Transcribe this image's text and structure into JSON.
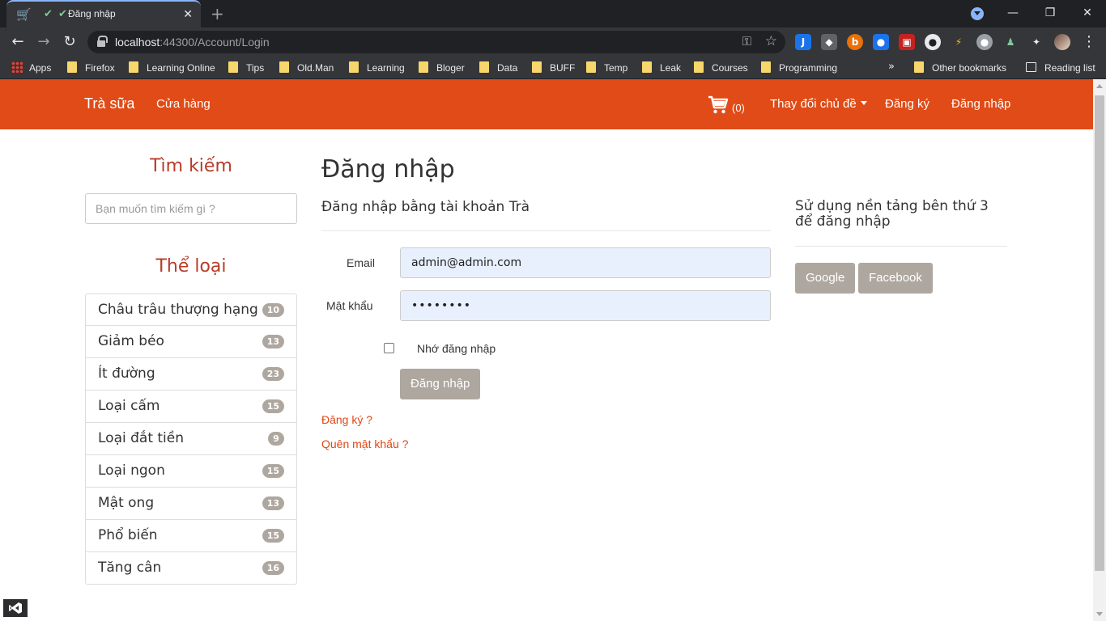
{
  "browser": {
    "tab": {
      "title": "Đăng nhập"
    },
    "url": {
      "host": "localhost",
      "rest": ":44300/Account/Login"
    },
    "bookmarks": [
      {
        "label": "Apps",
        "type": "apps"
      },
      {
        "label": "Firefox",
        "type": "folder"
      },
      {
        "label": "Learning Online",
        "type": "folder"
      },
      {
        "label": "Tips",
        "type": "folder"
      },
      {
        "label": "Old.Man",
        "type": "folder"
      },
      {
        "label": "Learning",
        "type": "folder"
      },
      {
        "label": "Bloger",
        "type": "folder"
      },
      {
        "label": "Data",
        "type": "folder"
      },
      {
        "label": "BUFF",
        "type": "folder"
      },
      {
        "label": "Temp",
        "type": "folder"
      },
      {
        "label": "Leak",
        "type": "folder"
      },
      {
        "label": "Courses",
        "type": "folder"
      },
      {
        "label": "Programming",
        "type": "folder"
      }
    ],
    "other_bookmarks": "Other bookmarks",
    "reading_list": "Reading list",
    "more": "»"
  },
  "nav": {
    "brand": "Trà sữa",
    "shop": "Cửa hàng",
    "cart_count": "(0)",
    "theme": "Thay đổi chủ đề",
    "register": "Đăng ký",
    "login": "Đăng nhập"
  },
  "sidebar": {
    "search_heading": "Tìm kiếm",
    "search_placeholder": "Bạn muốn tìm kiếm gì ?",
    "categories_heading": "Thể loại",
    "categories": [
      {
        "label": "Châu trâu thượng hạng",
        "count": "10"
      },
      {
        "label": "Giảm béo",
        "count": "13"
      },
      {
        "label": "Ít đường",
        "count": "23"
      },
      {
        "label": "Loại cấm",
        "count": "15"
      },
      {
        "label": "Loại đắt tiền",
        "count": "9"
      },
      {
        "label": "Loại ngon",
        "count": "15"
      },
      {
        "label": "Mật ong",
        "count": "13"
      },
      {
        "label": "Phổ biến",
        "count": "15"
      },
      {
        "label": "Tăng cân",
        "count": "16"
      }
    ]
  },
  "login": {
    "title": "Đăng nhập",
    "local_heading": "Đăng nhập bằng tài khoản Trà",
    "email_label": "Email",
    "email_value": "admin@admin.com",
    "password_label": "Mật khẩu",
    "password_value": "••••••••",
    "remember_label": "Nhớ đăng nhập",
    "submit": "Đăng nhập",
    "register_link": "Đăng ký ?",
    "forgot_link": "Quên mật khẩu ?"
  },
  "external": {
    "heading": "Sử dụng nền tảng bên thứ 3 để đăng nhập",
    "google": "Google",
    "facebook": "Facebook"
  },
  "colors": {
    "navbar": "#e04b17",
    "accent_text": "#b83c28",
    "link": "#dd4814",
    "badge": "#aea79f",
    "button": "#aea79f"
  }
}
